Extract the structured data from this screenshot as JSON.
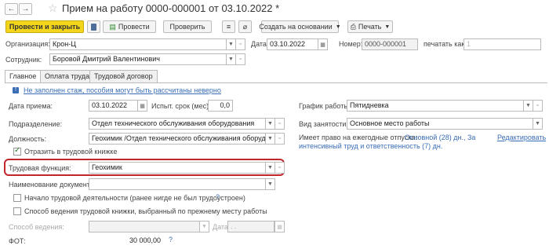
{
  "window": {
    "title": "Прием на работу 0000-000001 от 03.10.2022 *"
  },
  "toolbar": {
    "post_close": "Провести и закрыть",
    "post": "Провести",
    "check": "Проверить",
    "create_based": "Создать на основании",
    "print": "Печать"
  },
  "header": {
    "org_label": "Организация:",
    "org_value": "Крон-Ц",
    "date_label": "Дата:",
    "date_value": "03.10.2022",
    "number_label": "Номер:",
    "number_value": "0000-000001",
    "print_as_label": "печатать как:",
    "print_as_value": "1",
    "employee_label": "Сотрудник:",
    "employee_value": "Боровой Дмитрий Валентинович"
  },
  "tabs": [
    "Главное",
    "Оплата труда",
    "Трудовой договор"
  ],
  "main": {
    "warning": "Не заполнен стаж, пособия могут быть рассчитаны неверно",
    "hire_date_label": "Дата приема:",
    "hire_date_value": "03.10.2022",
    "probation_label": "Испыт. срок (мес):",
    "probation_value": "0,0",
    "department_label": "Подразделение:",
    "department_value": "Отдел технического обслуживания оборудования",
    "position_label": "Должность:",
    "position_value": "Геохимик /Отдел технического обслуживания оборудования",
    "workbook_check_label": "Отразить в трудовой книжке",
    "labor_function_label": "Трудовая функция:",
    "labor_function_value": "Геохимик",
    "doc_name_label": "Наименование документа:",
    "doc_name_value": "",
    "start_activity_label": "Начало трудовой деятельности (ранее нигде не был трудоустроен)",
    "workbook_method_label": "Способ ведения трудовой книжки, выбранный по прежнему месту работы",
    "method_label": "Способ ведения:",
    "date2_label": "Дата:",
    "date2_value": ". .",
    "fot_label": "ФОТ:",
    "fot_value": "30 000,00",
    "schedule_label": "График работы:",
    "schedule_value": "Пятидневка",
    "employment_label": "Вид занятости:",
    "employment_value": "Основное место работы",
    "vacation_prefix": "Имеет право на ежегодные отпуска:",
    "vacation_link": "Основной (28) дн., За интенсивный труд и ответственность (7) дн.",
    "vacation_link_line1": "Основной (28) дн., За",
    "vacation_link_line2": "интенсивный труд и ответственность (7) дн.",
    "edit_link": "Редактировать"
  }
}
